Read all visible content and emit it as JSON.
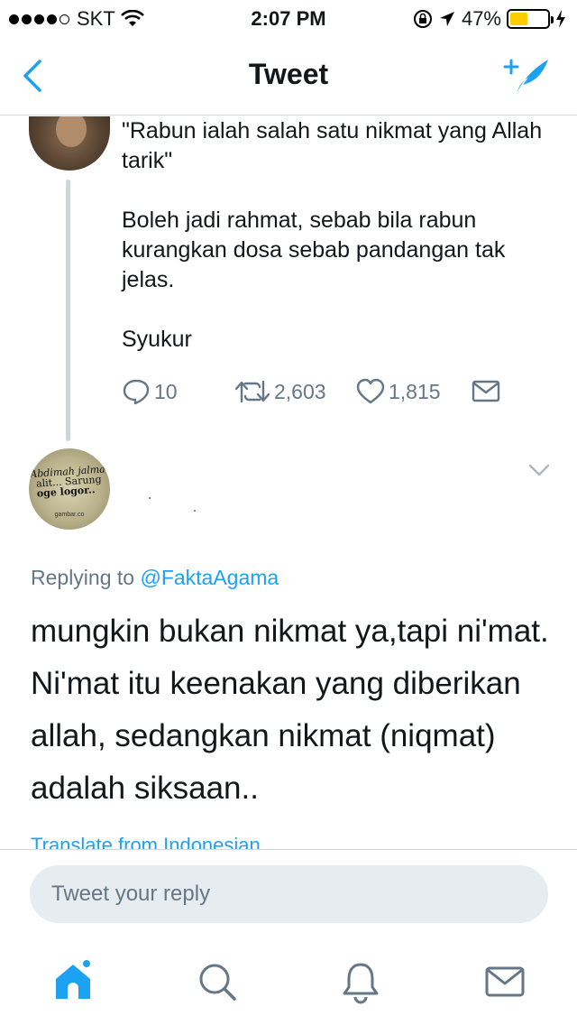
{
  "status_bar": {
    "carrier": "SKT",
    "time": "2:07 PM",
    "battery_percent": "47%",
    "battery_level": 0.47,
    "battery_color": "#ffcc00"
  },
  "nav": {
    "title": "Tweet",
    "back_icon": "chevron-left-icon",
    "compose_icon": "compose-tweet-icon",
    "accent_color": "#1da1f2"
  },
  "parent_tweet": {
    "paragraphs": [
      "\"Rabun ialah salah satu nikmat yang Allah tarik\"",
      "Boleh jadi rahmat, sebab bila rabun kurangkan dosa sebab pandangan tak jelas.",
      "Syukur"
    ],
    "replies": "10",
    "retweets": "2,603",
    "likes": "1,815"
  },
  "reply_tweet": {
    "avatar_text_lines": [
      "Abdimah jalma",
      "alit... Sarung",
      "oge logor..",
      "gambar.co"
    ],
    "replying_prefix": "Replying to ",
    "replying_handle": "@FaktaAgama",
    "text": "mungkin bukan nikmat ya,tapi ni'mat. Ni'mat itu keenakan yang diberikan allah, sedangkan nikmat (niqmat) adalah siksaan..",
    "translate_label": "Translate from Indonesian"
  },
  "reply_box": {
    "placeholder": "Tweet your reply"
  },
  "tab_bar": {
    "tabs": [
      "home-icon",
      "search-icon",
      "notifications-icon",
      "messages-icon"
    ]
  }
}
